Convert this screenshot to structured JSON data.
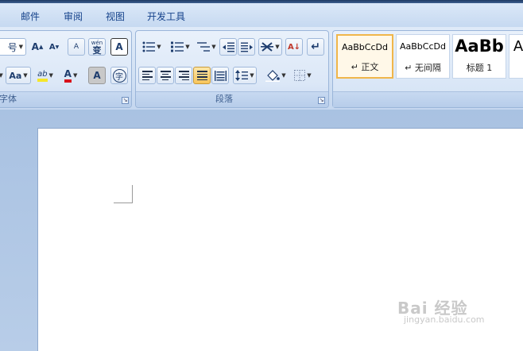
{
  "tabs": [
    "邮件",
    "审阅",
    "视图",
    "开发工具"
  ],
  "font_group": {
    "label": "字体",
    "size_value": "号",
    "grow_font": "A",
    "shrink_font": "A",
    "clear_format_glyph": "A",
    "phonetic_glyph": "变",
    "phonetic_top": "wén",
    "char_border": "A",
    "change_case": "Aa",
    "highlight": "ab",
    "font_color": "A",
    "char_shading": "A",
    "enclose_char": "字"
  },
  "paragraph_group": {
    "label": "段落",
    "sort_glyph": "A↓",
    "show_marks": "↵"
  },
  "styles_group": {
    "items": [
      {
        "sample": "AaBbCcDd",
        "name": "↵ 正文",
        "selected": true
      },
      {
        "sample": "AaBbCcDd",
        "name": "↵ 无间隔",
        "selected": false
      },
      {
        "sample": "AaBb",
        "name": "标题 1",
        "selected": false
      },
      {
        "sample": "A",
        "name": "",
        "selected": false
      }
    ]
  },
  "watermark": {
    "main": "Bai 经验",
    "sub": "jingyan.baidu.com"
  },
  "colors": {
    "highlight_color": "#f5e62a",
    "font_color_bar": "#d8101a",
    "selected_style_border": "#f0b64a"
  }
}
